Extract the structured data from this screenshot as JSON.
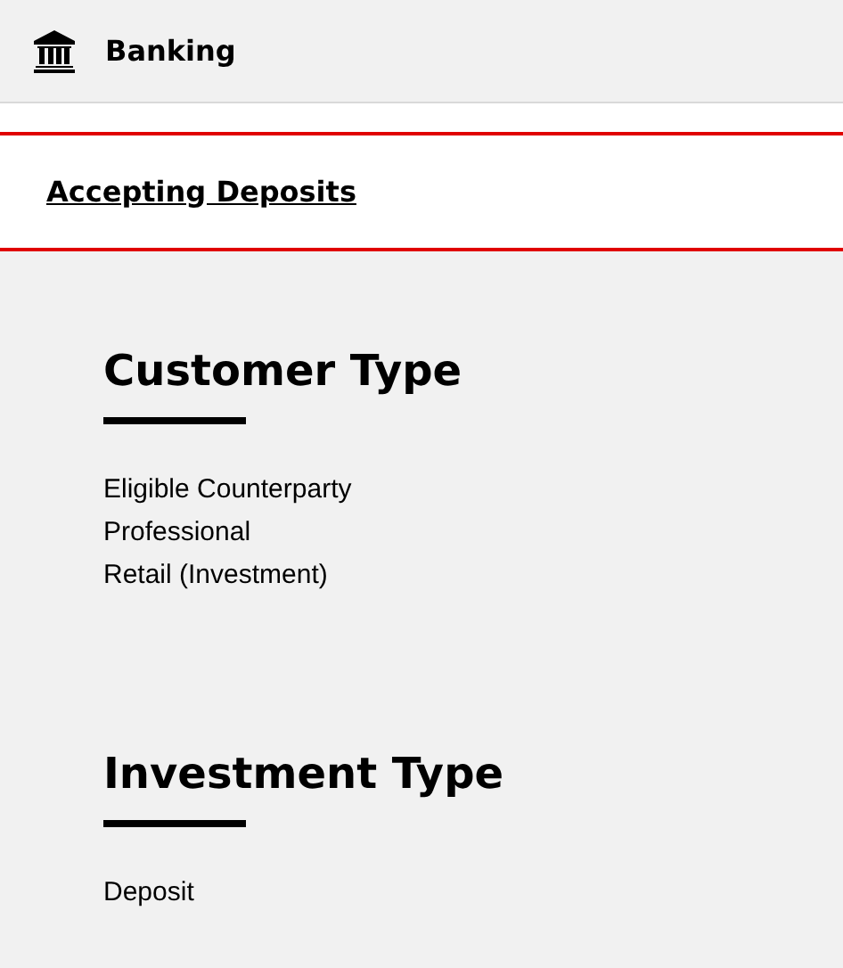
{
  "header": {
    "title": "Banking"
  },
  "activity": {
    "label": "Accepting Deposits"
  },
  "sections": [
    {
      "title": "Customer Type",
      "items": [
        "Eligible Counterparty",
        "Professional",
        "Retail (Investment)"
      ]
    },
    {
      "title": "Investment Type",
      "items": [
        "Deposit"
      ]
    }
  ]
}
